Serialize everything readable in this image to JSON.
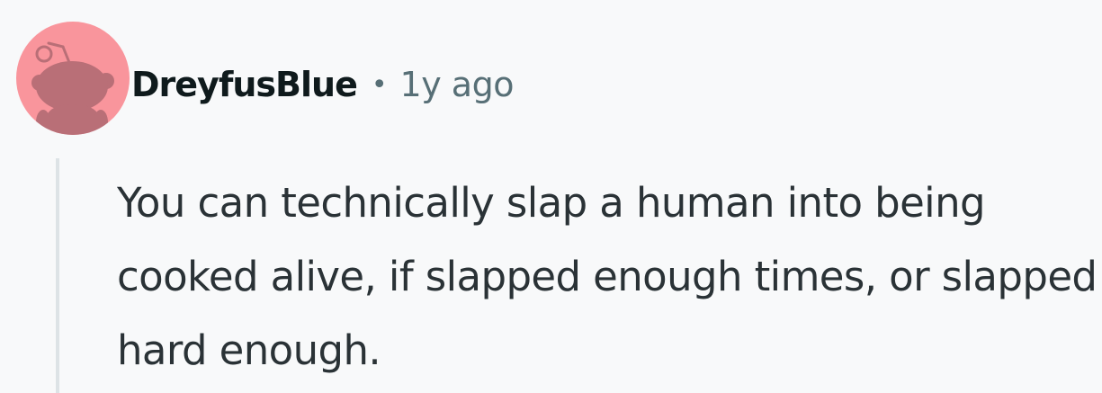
{
  "comment": {
    "username": "DreyfusBlue",
    "separator": "•",
    "timestamp": "1y ago",
    "body": "You can technically slap a human into being cooked alive, if slapped enough times, or slapped hard enough."
  },
  "icons": {
    "avatar": "reddit-snoo-avatar-icon"
  },
  "colors": {
    "avatar_background": "#f9959c",
    "avatar_figure": "#b96f77",
    "page_background": "#f8f9fa",
    "username": "#0f1a1c",
    "meta_text": "#576f76",
    "body_text": "#2a3236",
    "thread_line": "#dde3e6"
  }
}
